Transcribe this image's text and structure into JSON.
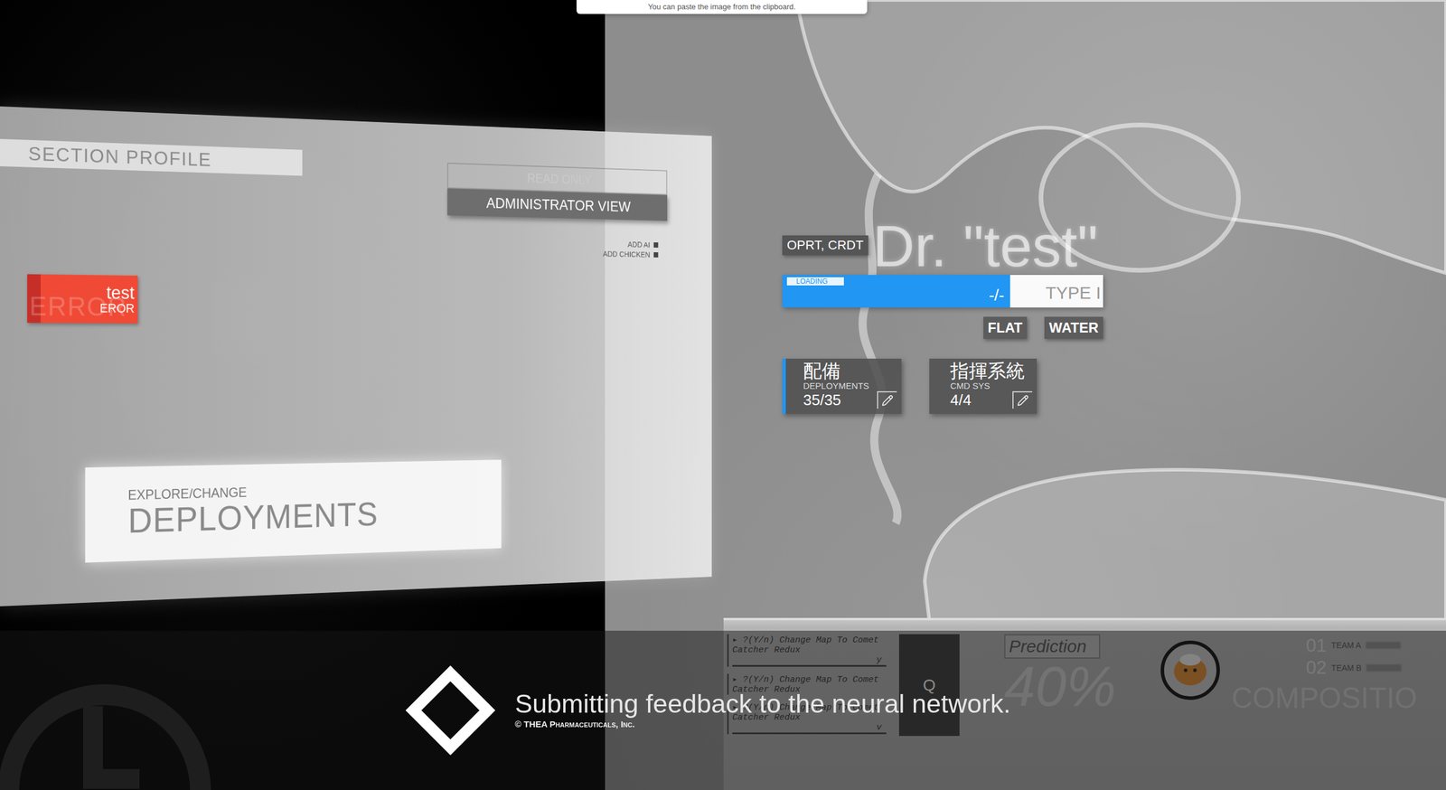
{
  "popup": {
    "text": "You can paste the image from the clipboard."
  },
  "profile_panel": {
    "header": "SECTION PROFILE",
    "mode_badge": "READ ONLY",
    "view_button": "ADMINISTRATOR VIEW",
    "status_tag": {
      "title": "test",
      "code": "EROR",
      "ghost": "ERROR"
    },
    "actions": [
      {
        "label": "ADD AI"
      },
      {
        "label": "ADD CHICKEN"
      }
    ],
    "deployments_card": {
      "kicker": "EXPLORE/CHANGE",
      "title": "DEPLOYMENTS"
    }
  },
  "unit": {
    "name": "Dr. \"test\"",
    "role_tag": "OPRT, CRDT",
    "loading": {
      "label": "LOADING",
      "level": 0.71,
      "reading": "-/-"
    },
    "type_field": {
      "value": "TYPE I"
    },
    "tags": [
      {
        "label": "FLAT"
      },
      {
        "label": "WATER"
      }
    ],
    "stats": [
      {
        "title": "配備",
        "subtitle": "DEPLOYMENTS",
        "value": "35/35",
        "selected": true
      },
      {
        "title": "指揮系統",
        "subtitle": "CMD SYS",
        "value": "4/4",
        "selected": false
      }
    ]
  },
  "background_console": {
    "lines": [
      {
        "text": "▸ ?(Y/n) Change Map To Comet Catcher Redux",
        "mark": "y"
      },
      {
        "text": "▸ ?(Y/n) Change Map To Comet Catcher Redux"
      },
      {
        "text": "▸ ?(Y/n) Change Map To Comet Catcher Redux",
        "mark": "v"
      }
    ],
    "search_icon": "Q",
    "prediction": {
      "label": "Prediction",
      "value": "40%"
    },
    "teams": [
      {
        "rank": "01",
        "name": "TEAM A"
      },
      {
        "rank": "02",
        "name": "TEAM B"
      }
    ],
    "composition": "COMPOSITIO"
  },
  "loading_overlay": {
    "message": "Submitting feedback to the neural network.",
    "copyright": "© THEA Pharmaceuticals, Inc."
  }
}
